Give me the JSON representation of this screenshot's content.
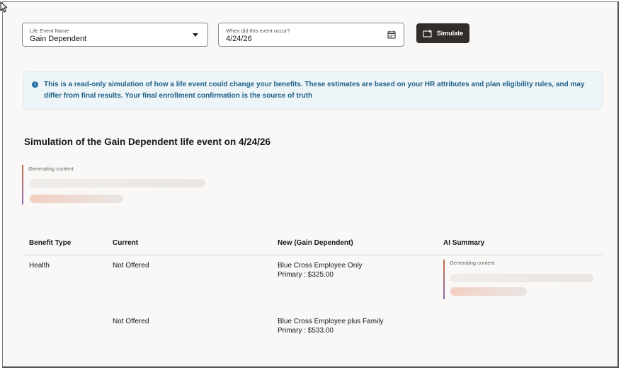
{
  "form": {
    "life_event": {
      "label": "Life Event Name",
      "value": "Gain Dependent"
    },
    "event_date": {
      "label": "When did this event occur?",
      "value": "4/24/26"
    },
    "simulate_label": "Simulate"
  },
  "banner": {
    "text": "This is a read-only simulation of how a life event could change your benefits. These estimates are based on your HR attributes and plan eligibility rules, and may differ from final results. Your final enrollment confirmation is the source of truth"
  },
  "section_title": "Simulation of the Gain Dependent life event on 4/24/26",
  "summary_generating": "Generating content",
  "table": {
    "headers": [
      "Benefit Type",
      "Current",
      "New (Gain Dependent)",
      "AI Summary"
    ],
    "rows": [
      {
        "benefit": "Health",
        "current": "Not Offered",
        "new_plan": "Blue Cross Employee Only",
        "new_cost": "Primary : $325.00",
        "ai": "Generating content"
      },
      {
        "benefit": "",
        "current": "Not Offered",
        "new_plan": "Blue Cross Employee plus Family",
        "new_cost": "Primary : $533.00",
        "ai": ""
      }
    ]
  },
  "colors": {
    "primary_button": "#312d2a",
    "info_text": "#1d5f86",
    "banner_bg": "#eef5f8"
  }
}
